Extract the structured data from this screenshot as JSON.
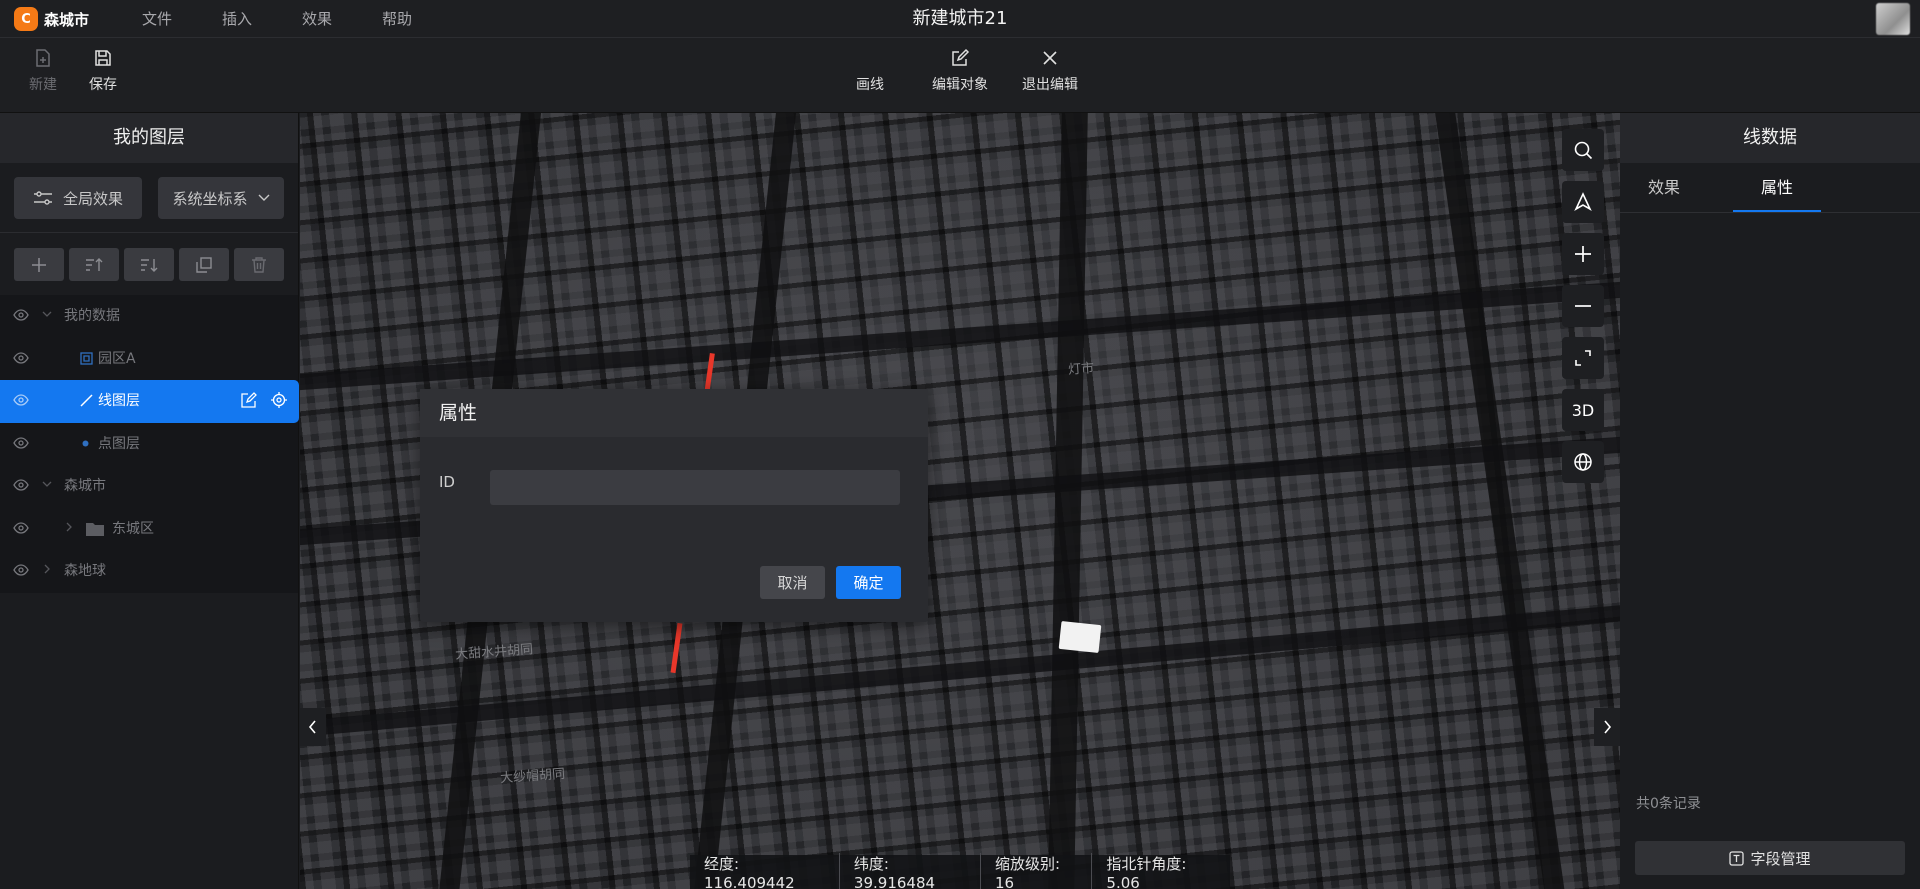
{
  "app": {
    "logo_mark": "C",
    "name": "森城市",
    "title": "新建城市21"
  },
  "menu": [
    "文件",
    "插入",
    "效果",
    "帮助"
  ],
  "toolbar": {
    "new_label": "新建",
    "save_label": "保存",
    "draw_line_label": "画线",
    "edit_object_label": "编辑对象",
    "exit_edit_label": "退出编辑"
  },
  "left_panel": {
    "title": "我的图层",
    "global_effect_label": "全局效果",
    "coord_system_label": "系统坐标系",
    "tree": [
      {
        "label": "我的数据",
        "level": 0,
        "type": "group",
        "expanded": true
      },
      {
        "label": "园区A",
        "level": 1,
        "type": "model"
      },
      {
        "label": "线图层",
        "level": 1,
        "type": "line",
        "active": true
      },
      {
        "label": "点图层",
        "level": 1,
        "type": "point"
      },
      {
        "label": "森城市",
        "level": 0,
        "type": "group",
        "expanded": true
      },
      {
        "label": "东城区",
        "level": 1,
        "type": "folder"
      },
      {
        "label": "森地球",
        "level": 0,
        "type": "group",
        "expanded": false
      }
    ]
  },
  "map": {
    "controls": [
      "search-icon",
      "compass-icon",
      "zoom-in-icon",
      "zoom-out-icon",
      "fullscreen-icon",
      "3D",
      "globe-icon"
    ],
    "mode_label": "3D",
    "street_labels": [
      "大甜水井胡同",
      "大纱帽胡同",
      "灯市"
    ],
    "status": {
      "longitude": "经度: 116.409442",
      "latitude": "纬度: 39.916484",
      "zoom": "缩放级别: 16",
      "heading": "指北针角度: 5.06"
    }
  },
  "dialog": {
    "title": "属性",
    "field_label": "ID",
    "field_value": "",
    "cancel_label": "取消",
    "ok_label": "确定"
  },
  "right_panel": {
    "title": "线数据",
    "tabs": [
      "效果",
      "属性"
    ],
    "active_tab": "属性",
    "record_count": "共0条记录",
    "field_manage_label": "字段管理"
  },
  "colors": {
    "accent": "#1478f0",
    "logo": "#f57a16",
    "highlight_line": "#e8372a"
  }
}
